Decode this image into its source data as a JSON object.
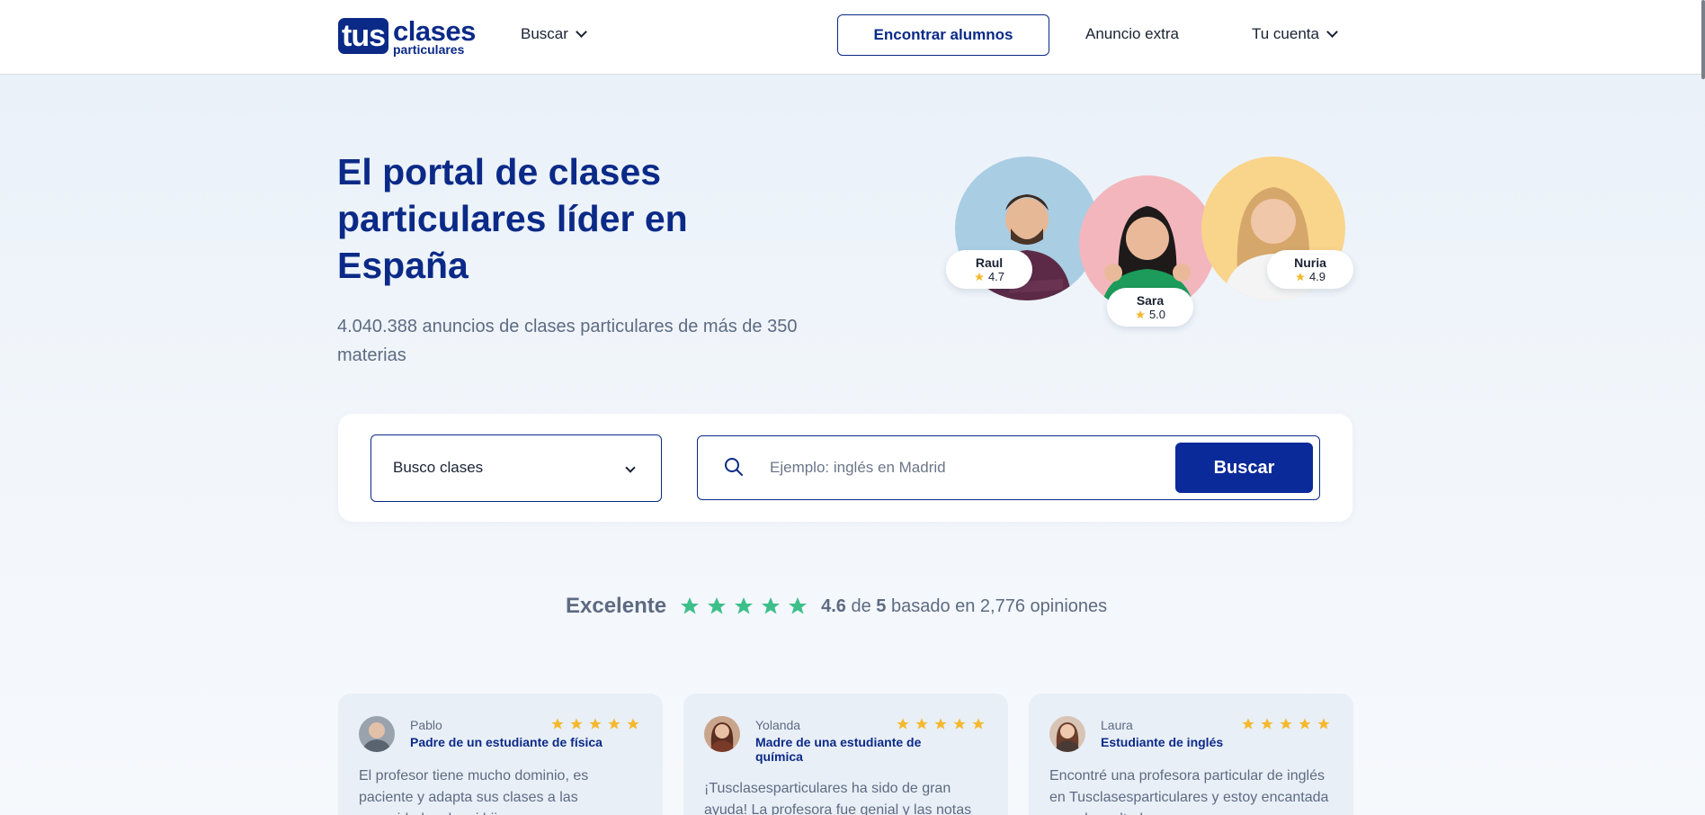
{
  "header": {
    "logo_tus": "tus",
    "logo_clases": "clases",
    "logo_particulares": "particulares",
    "nav_buscar": "Buscar",
    "btn_encontrar": "Encontrar alumnos",
    "nav_anuncio": "Anuncio extra",
    "nav_cuenta": "Tu cuenta"
  },
  "hero": {
    "title": "El portal de clases particulares líder en España",
    "subtitle": "4.040.388 anuncios de clases particulares de más de 350 materias",
    "tutors": [
      {
        "name": "Raul",
        "rating": "4.7"
      },
      {
        "name": "Sara",
        "rating": "5.0"
      },
      {
        "name": "Nuria",
        "rating": "4.9"
      }
    ]
  },
  "search": {
    "select_value": "Busco clases",
    "placeholder": "Ejemplo: inglés en Madrid",
    "button": "Buscar"
  },
  "rating": {
    "label": "Excelente",
    "score": "4.6",
    "of": "de",
    "max": "5",
    "suffix": "basado en 2,776 opiniones"
  },
  "reviews": [
    {
      "name": "Pablo",
      "role": "Padre de un estudiante de física",
      "text": "El profesor tiene mucho dominio, es paciente y adapta sus clases a las necesidades de mi hijo."
    },
    {
      "name": "Yolanda",
      "role": "Madre de una estudiante de química",
      "text": "¡Tusclasesparticulares ha sido de gran ayuda! La profesora fue genial y las notas mejoraron."
    },
    {
      "name": "Laura",
      "role": "Estudiante de inglés",
      "text": "Encontré una profesora particular de inglés en Tusclasesparticulares y estoy encantada con el resultado."
    }
  ],
  "colors": {
    "brand": "#0b2a88",
    "star_green": "#3dbf8a",
    "star_gold": "#f5b82e"
  }
}
